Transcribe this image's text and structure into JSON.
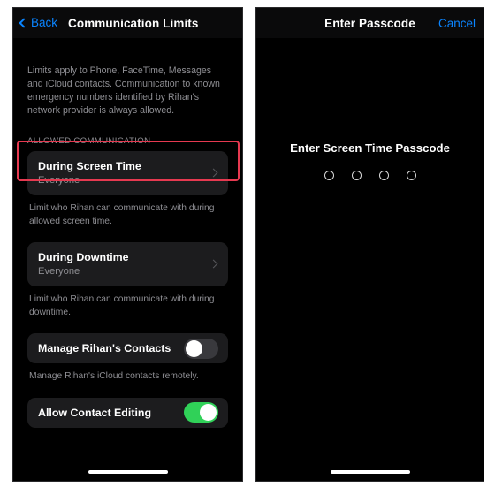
{
  "left_phone": {
    "navbar": {
      "back_label": "Back",
      "title": "Communication Limits"
    },
    "intro_text": "Limits apply to Phone, FaceTime, Messages and iCloud contacts. Communication to known emergency numbers identified by Rihan's network provider is always allowed.",
    "group_header": "ALLOWED COMMUNICATION",
    "during_screen_time": {
      "title": "During Screen Time",
      "value": "Everyone",
      "footnote": "Limit who Rihan can communicate with during allowed screen time."
    },
    "during_downtime": {
      "title": "During Downtime",
      "value": "Everyone",
      "footnote": "Limit who Rihan can communicate with during downtime."
    },
    "manage_contacts": {
      "label": "Manage Rihan's Contacts",
      "state": "off",
      "footnote": "Manage Rihan's iCloud contacts remotely."
    },
    "allow_contact_editing": {
      "label": "Allow Contact Editing",
      "state": "on"
    }
  },
  "right_phone": {
    "navbar": {
      "title": "Enter Passcode",
      "cancel_label": "Cancel"
    },
    "prompt": "Enter Screen Time Passcode",
    "dot_count": 4,
    "filled_dots": 0
  },
  "colors": {
    "accent_blue": "#0a84ff",
    "toggle_on_green": "#30d158",
    "highlight_red": "#e63950",
    "card_background": "#1c1c1e",
    "secondary_text": "#8e8e93"
  }
}
